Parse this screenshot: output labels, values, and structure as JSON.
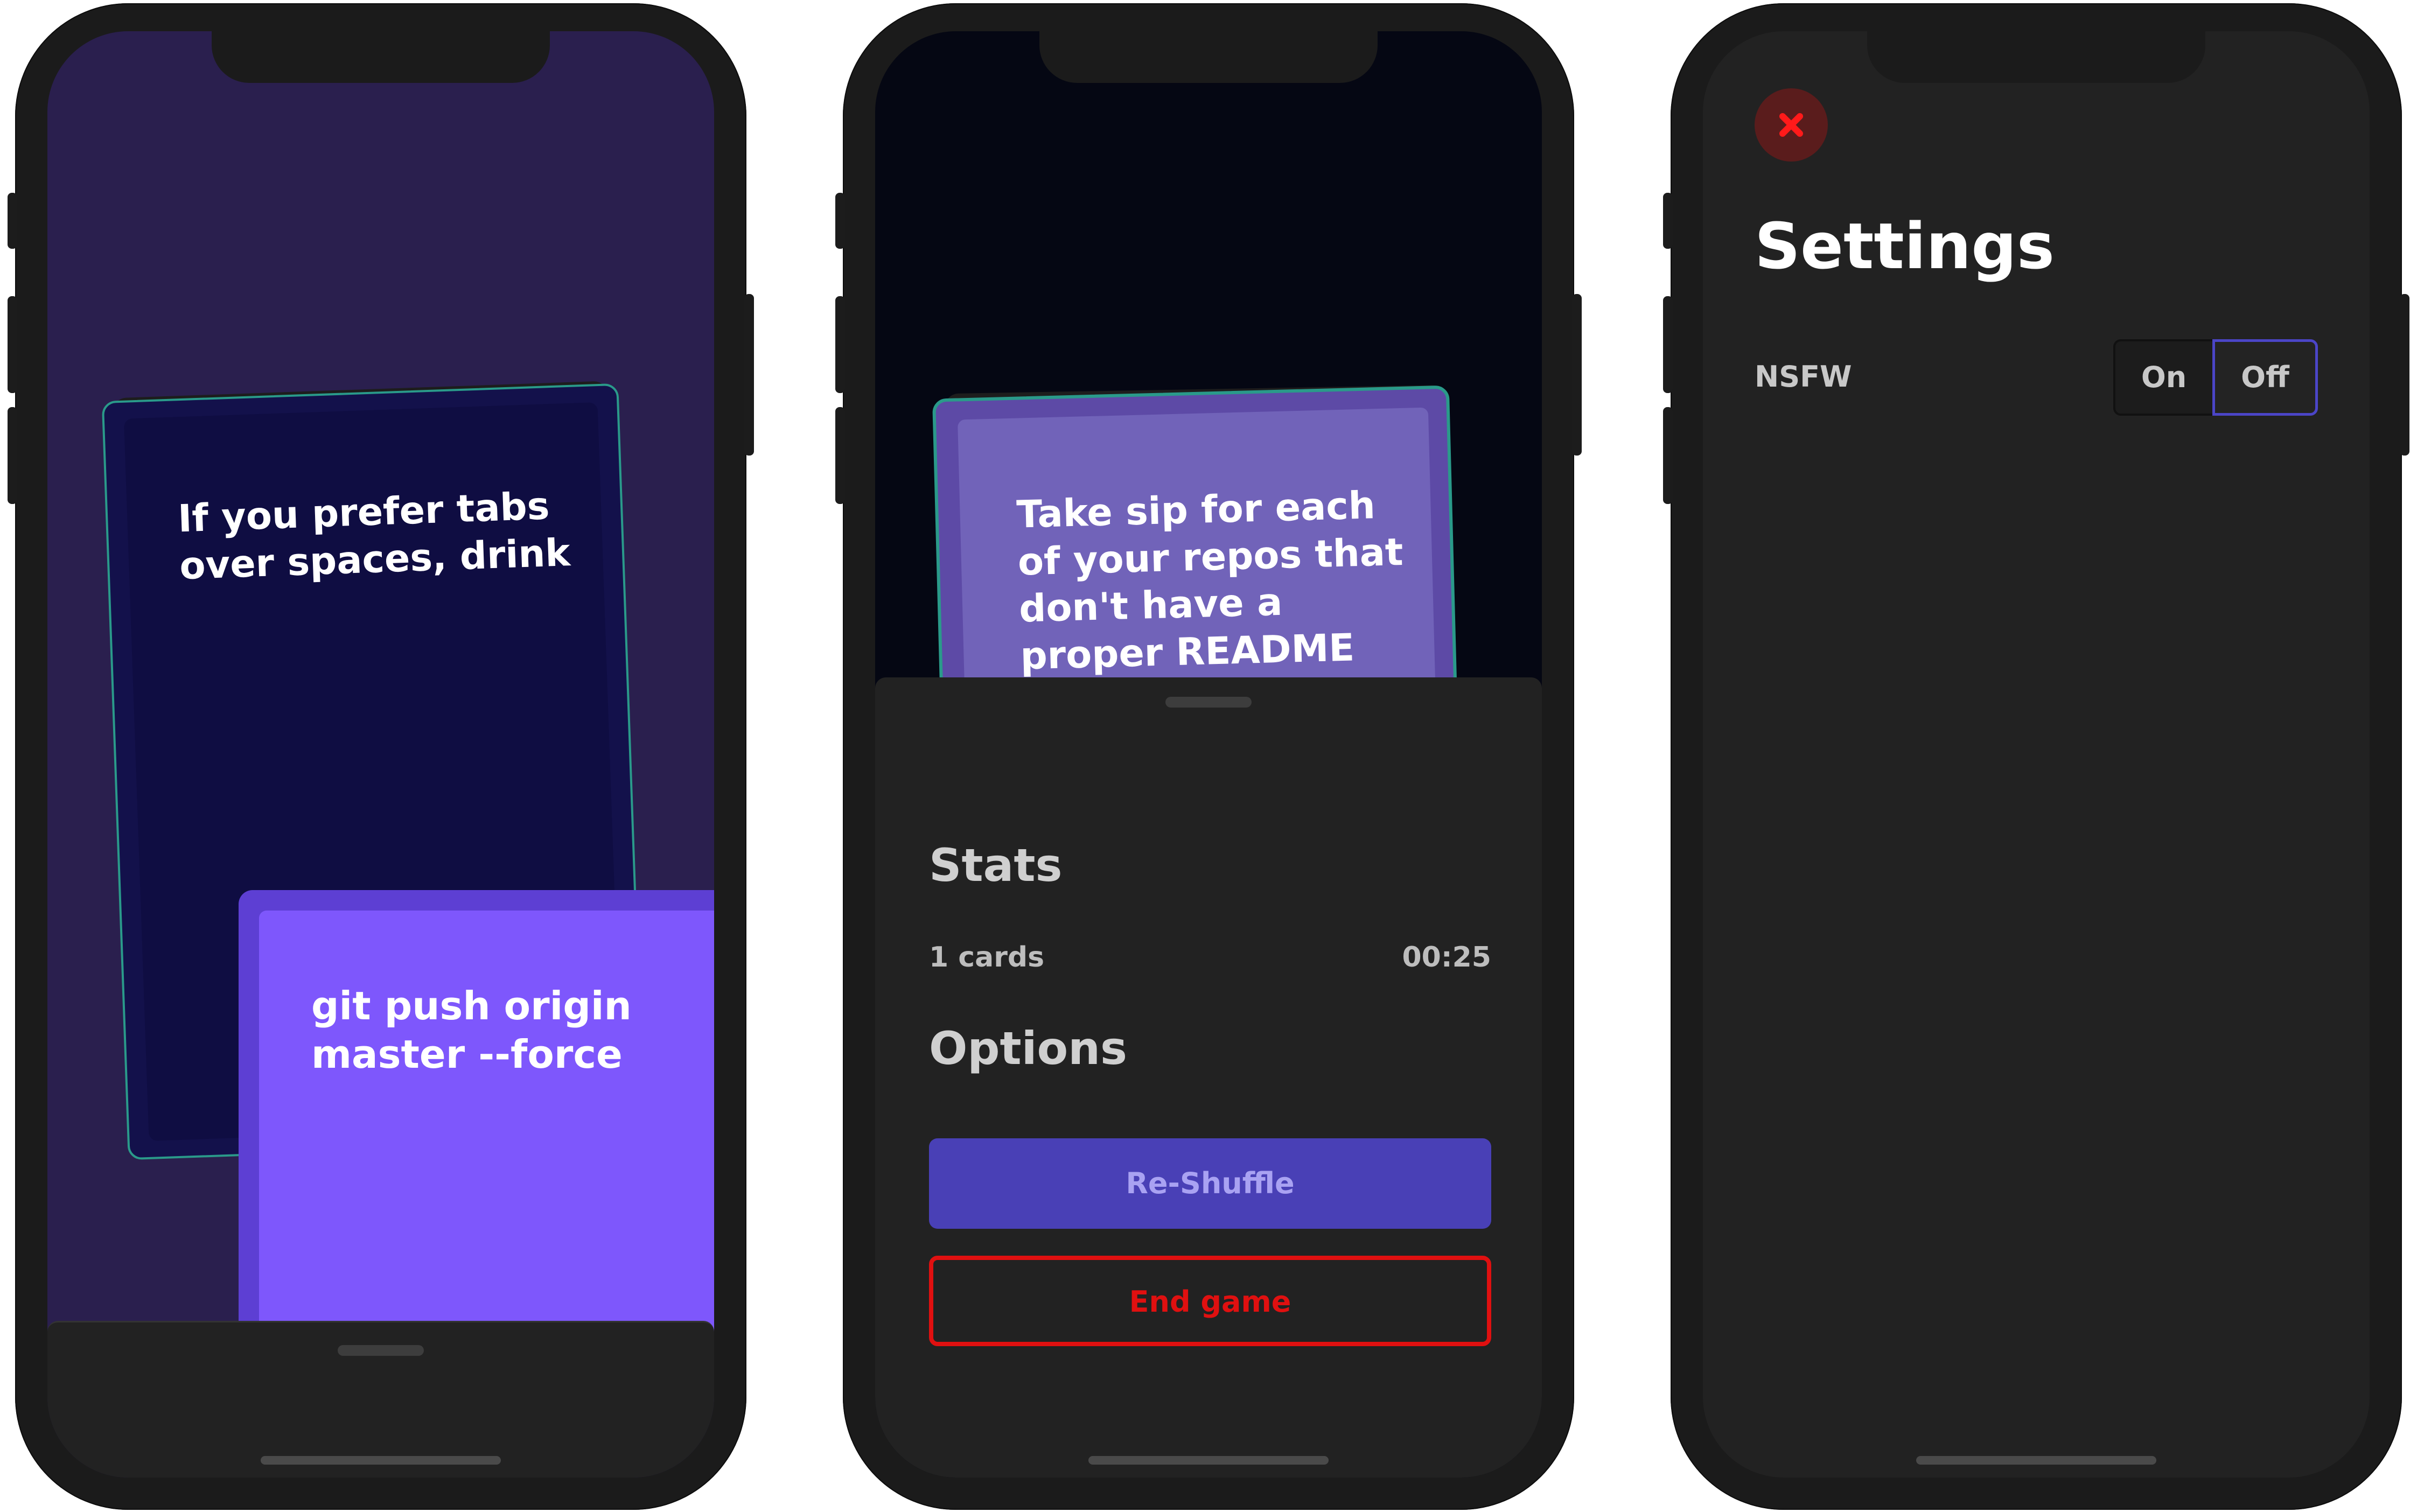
{
  "colors": {
    "phone_frame": "#1b1b1b",
    "game_background": "#2a1f4e",
    "dark_background": "#050713",
    "sheet_background": "#222222",
    "card_navy": "#13114b",
    "card_violet": "#7e57fc",
    "card_lavender": "#7163b9",
    "accent_teal": "#2a9a8a",
    "reshuffle_button": "#4940b6",
    "end_game_red": "#e01010",
    "toggle_border_active": "#4b45c7"
  },
  "phone1": {
    "back_card": {
      "text": "If you prefer tabs over spaces, drink"
    },
    "front_card": {
      "text": "git push origin master --force"
    }
  },
  "phone2": {
    "card": {
      "text": "Take sip for each of your repos that don't have a proper README"
    },
    "stats": {
      "title": "Stats",
      "cards_count": "1 cards",
      "timer": "00:25"
    },
    "options": {
      "title": "Options",
      "reshuffle_label": "Re-Shuffle",
      "end_game_label": "End game"
    }
  },
  "phone3": {
    "close_icon": "close-icon",
    "title": "Settings",
    "nsfw": {
      "label": "NSFW",
      "on_label": "On",
      "off_label": "Off",
      "selected": "Off"
    }
  }
}
